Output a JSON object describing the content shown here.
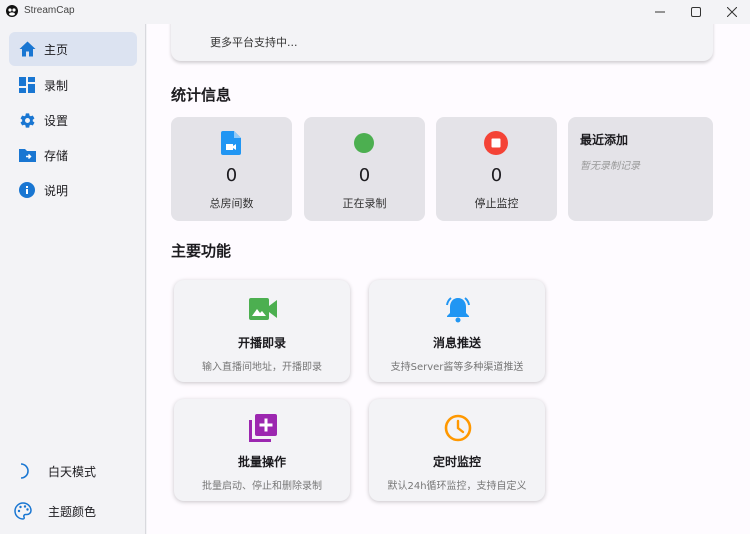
{
  "window": {
    "title": "StreamCap"
  },
  "sidebar": {
    "items": [
      {
        "label": "主页",
        "icon": "home-icon",
        "active": true
      },
      {
        "label": "录制",
        "icon": "dashboard-icon",
        "active": false
      },
      {
        "label": "设置",
        "icon": "gear-icon",
        "active": false
      },
      {
        "label": "存储",
        "icon": "folder-icon",
        "active": false
      },
      {
        "label": "说明",
        "icon": "info-icon",
        "active": false
      }
    ],
    "bottom": [
      {
        "label": "白天模式",
        "icon": "moon-icon"
      },
      {
        "label": "主题颜色",
        "icon": "palette-icon"
      }
    ]
  },
  "main": {
    "platform_card_text": "更多平台支持中...",
    "stats_title": "统计信息",
    "stats": [
      {
        "value": "0",
        "caption": "总房间数",
        "icon": "video-file-icon",
        "color": "#2196f3"
      },
      {
        "value": "0",
        "caption": "正在录制",
        "icon": "green-dot-icon",
        "color": "#4caf50"
      },
      {
        "value": "0",
        "caption": "停止监控",
        "icon": "stop-circle-icon",
        "color": "#f44336"
      }
    ],
    "recent": {
      "title": "最近添加",
      "empty": "暂无录制记录"
    },
    "features_title": "主要功能",
    "features": [
      {
        "title": "开播即录",
        "desc": "输入直播间地址，开播即录",
        "icon": "video-camera-icon",
        "color": "#4caf50"
      },
      {
        "title": "消息推送",
        "desc": "支持Server酱等多种渠道推送",
        "icon": "bell-icon",
        "color": "#2196f3"
      },
      {
        "title": "批量操作",
        "desc": "批量启动、停止和删除录制",
        "icon": "library-add-icon",
        "color": "#9c27b0"
      },
      {
        "title": "定时监控",
        "desc": "默认24h循环监控，支持自定义",
        "icon": "clock-icon",
        "color": "#ff9800"
      }
    ]
  }
}
